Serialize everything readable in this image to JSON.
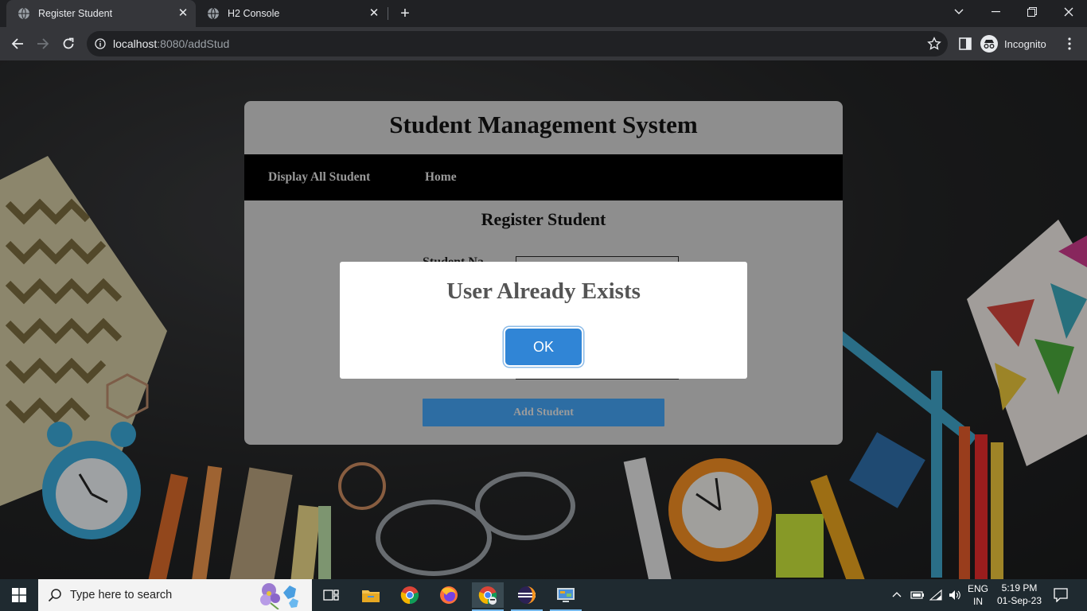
{
  "browser": {
    "tabs": [
      {
        "title": "Register Student",
        "active": true
      },
      {
        "title": "H2 Console",
        "active": false
      }
    ],
    "url_host": "localhost",
    "url_path": ":8080/addStud",
    "profile_label": "Incognito"
  },
  "page": {
    "title": "Student Management System",
    "nav": [
      "Display All Student",
      "Home"
    ],
    "form_title": "Register Student",
    "field_label": "Student Na",
    "submit_label": "Add Student"
  },
  "dialog": {
    "message": "User Already Exists",
    "ok_label": "OK"
  },
  "taskbar": {
    "search_placeholder": "Type here to search",
    "language": "ENG",
    "region": "IN",
    "time": "5:19 PM",
    "date": "01-Sep-23",
    "apps": [
      "task-view",
      "file-explorer",
      "chrome",
      "firefox",
      "chrome-incognito",
      "eclipse",
      "control-panel"
    ]
  },
  "colors": {
    "dialog_button": "#3085d6",
    "submit_button": "#2d6da3",
    "navbar": "#000000",
    "card": "#8e8e8e"
  }
}
